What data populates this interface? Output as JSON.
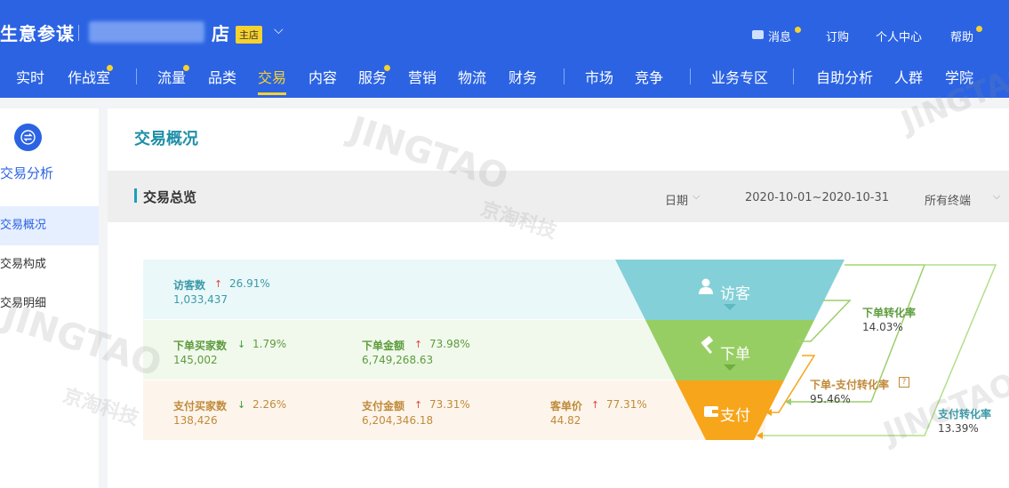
{
  "header": {
    "brand": "生意参谋",
    "shop_suffix": "店",
    "shop_badge": "主店",
    "chevron": "⌵",
    "links": [
      "消息",
      "订购",
      "个人中心",
      "帮助"
    ]
  },
  "nav": {
    "items": [
      "实时",
      "作战室",
      "流量",
      "品类",
      "交易",
      "内容",
      "服务",
      "营销",
      "物流",
      "财务",
      "市场",
      "竞争",
      "业务专区",
      "自助分析",
      "人群",
      "学院"
    ],
    "active": "交易"
  },
  "sidebar": {
    "title": "交易分析",
    "items": [
      "交易概况",
      "交易构成",
      "交易明细"
    ]
  },
  "page": {
    "title": "交易概况",
    "section_title": "交易总览",
    "date_label": "日期",
    "date_range": "2020-10-01~2020-10-31",
    "terminal": "所有终端"
  },
  "metrics": {
    "visitors": {
      "label": "访客数",
      "pct": "26.91%",
      "value": "1,033,437",
      "trend": "up"
    },
    "order_buyers": {
      "label": "下单买家数",
      "pct": "1.79%",
      "value": "145,002",
      "trend": "down"
    },
    "order_amount": {
      "label": "下单金额",
      "pct": "73.98%",
      "value": "6,749,268.63",
      "trend": "up"
    },
    "pay_buyers": {
      "label": "支付买家数",
      "pct": "2.26%",
      "value": "138,426",
      "trend": "down"
    },
    "pay_amount": {
      "label": "支付金额",
      "pct": "73.31%",
      "value": "6,204,346.18",
      "trend": "up"
    },
    "unit_price": {
      "label": "客单价",
      "pct": "77.31%",
      "value": "44.82",
      "trend": "up"
    }
  },
  "funnel": {
    "stages": [
      "访客",
      "下单",
      "支付"
    ],
    "colors": [
      "#84d0d8",
      "#97ce63",
      "#f7a51a"
    ],
    "order_conversion": {
      "label": "下单转化率",
      "value": "14.03%"
    },
    "order_pay_conversion": {
      "label": "下单-支付转化率",
      "value": "95.46%"
    },
    "pay_conversion": {
      "label": "支付转化率",
      "value": "13.39%"
    }
  },
  "watermark": {
    "logo": "JINGTAO",
    "cn": "京淘科技"
  },
  "colors": {
    "header_blue": "#2b63e3",
    "accent_yellow": "#f7d12e",
    "teal": "#1e8ea8"
  }
}
